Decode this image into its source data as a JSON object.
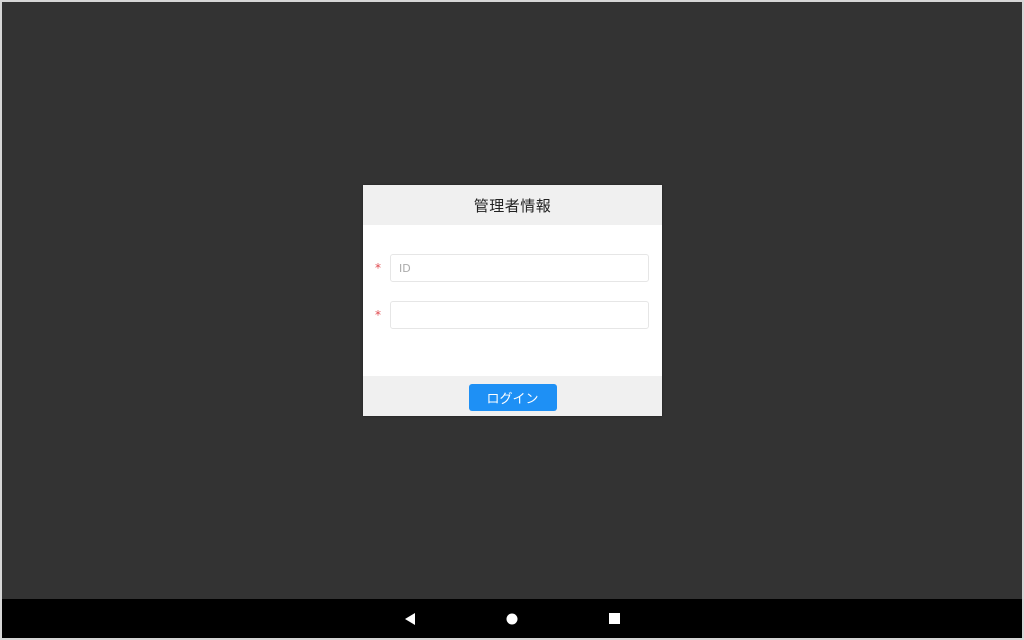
{
  "dialog": {
    "title": "管理者情報",
    "fields": [
      {
        "required_mark": "*",
        "placeholder": "ID",
        "value": ""
      },
      {
        "required_mark": "*",
        "placeholder": "",
        "value": ""
      }
    ],
    "login_label": "ログイン"
  },
  "nav": {
    "icons": [
      "back-icon",
      "home-icon",
      "recents-icon"
    ]
  },
  "colors": {
    "background": "#333333",
    "accent": "#1e90f5",
    "required": "#e0484d",
    "nav_bar": "#000000"
  }
}
